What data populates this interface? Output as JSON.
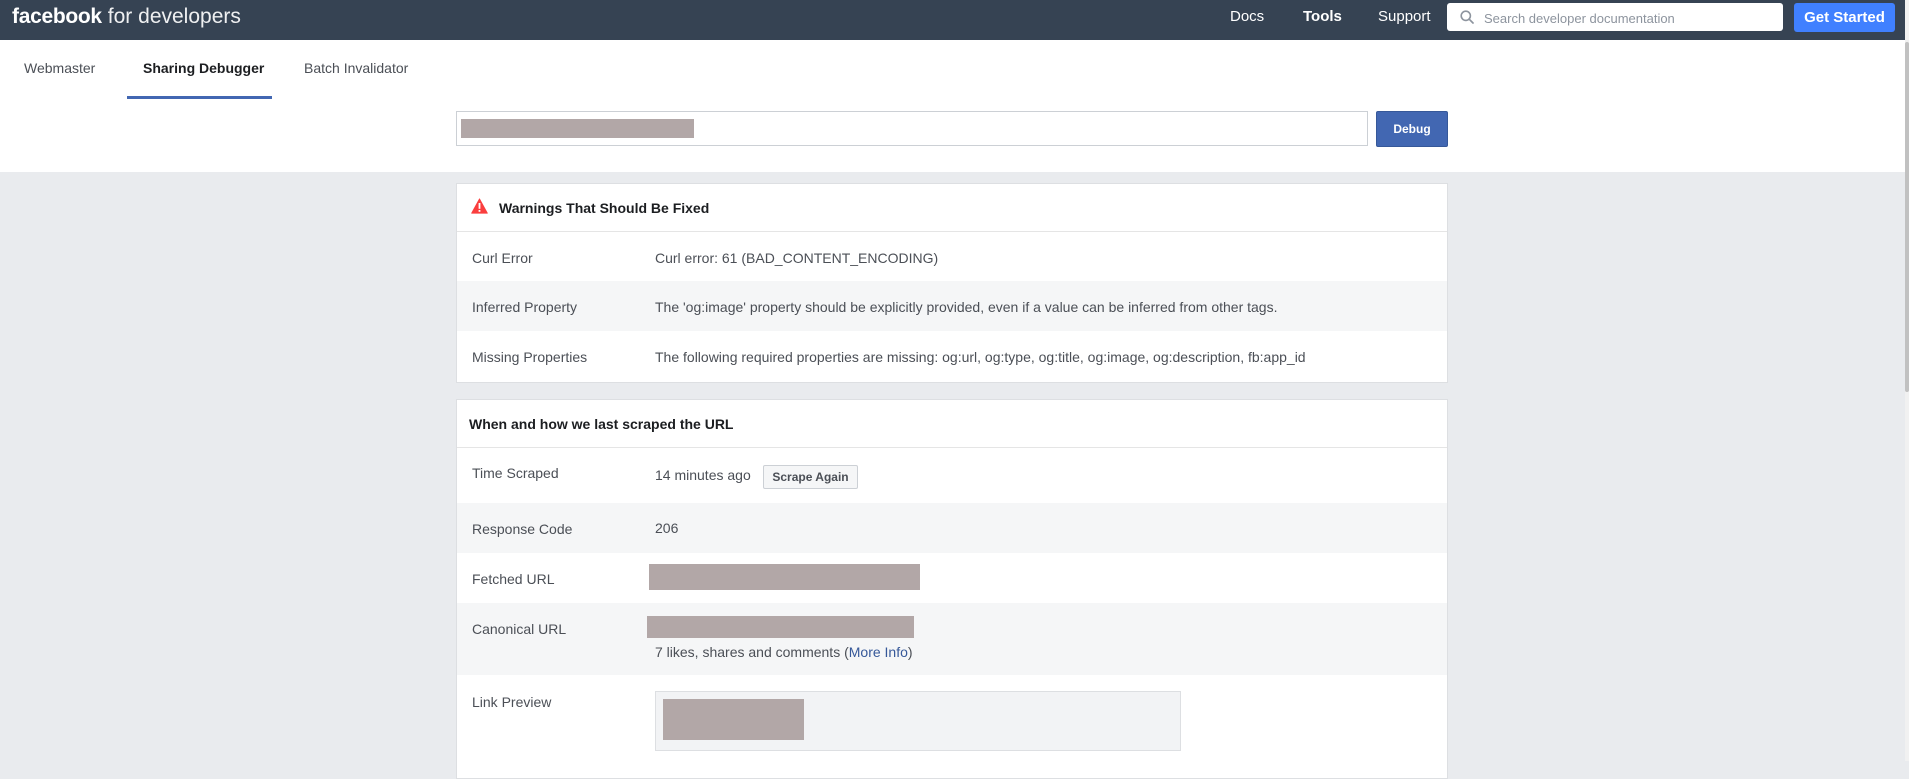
{
  "brand": {
    "name": "facebook",
    "suffix": "for developers"
  },
  "nav": {
    "docs": "Docs",
    "tools": "Tools",
    "support": "Support",
    "search_placeholder": "Search developer documentation",
    "get_started": "Get Started"
  },
  "tabs": [
    {
      "label": "Webmaster"
    },
    {
      "label": "Sharing Debugger",
      "active": true
    },
    {
      "label": "Batch Invalidator"
    }
  ],
  "debug_form": {
    "button_label": "Debug"
  },
  "warnings": {
    "title": "Warnings That Should Be Fixed",
    "rows": [
      {
        "label": "Curl Error",
        "value": "Curl error: 61 (BAD_CONTENT_ENCODING)"
      },
      {
        "label": "Inferred Property",
        "value": "The 'og:image' property should be explicitly provided, even if a value can be inferred from other tags."
      },
      {
        "label": "Missing Properties",
        "value": "The following required properties are missing: og:url, og:type, og:title, og:image, og:description, fb:app_id"
      }
    ]
  },
  "scrape": {
    "title": "When and how we last scraped the URL",
    "time_scraped": {
      "label": "Time Scraped",
      "value": "14 minutes ago",
      "button": "Scrape Again"
    },
    "response_code": {
      "label": "Response Code",
      "value": "206"
    },
    "fetched_url": {
      "label": "Fetched URL"
    },
    "canonical_url": {
      "label": "Canonical URL",
      "engagement_prefix": "7 likes, shares and comments (",
      "more_info": "More Info",
      "engagement_suffix": ")"
    },
    "link_preview": {
      "label": "Link Preview"
    }
  },
  "colors": {
    "topbar": "#364353",
    "primary_button": "#4267b2",
    "get_started": "#4080ff",
    "warning_icon": "#fa3e3e",
    "page_background": "#e9ebee"
  },
  "icons": {
    "search": "magnifier-icon",
    "warning": "warning-triangle-icon"
  }
}
